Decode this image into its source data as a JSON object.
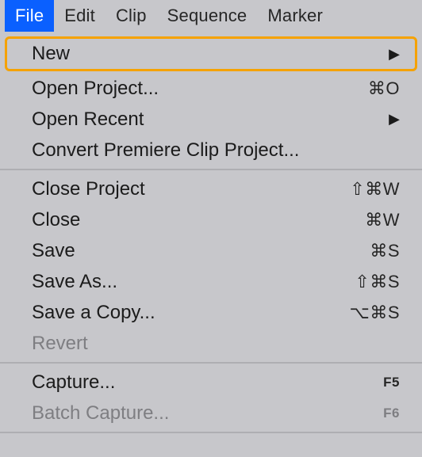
{
  "menubar": {
    "file": {
      "label": "File",
      "active": true
    },
    "edit": {
      "label": "Edit"
    },
    "clip": {
      "label": "Clip"
    },
    "sequence": {
      "label": "Sequence"
    },
    "marker": {
      "label": "Marker"
    }
  },
  "file_menu": {
    "new": {
      "label": "New"
    },
    "open_project": {
      "label": "Open Project...",
      "shortcut": "⌘O"
    },
    "open_recent": {
      "label": "Open Recent"
    },
    "convert": {
      "label": "Convert Premiere Clip Project..."
    },
    "close_project": {
      "label": "Close Project",
      "shortcut": "⇧⌘W"
    },
    "close": {
      "label": "Close",
      "shortcut": "⌘W"
    },
    "save": {
      "label": "Save",
      "shortcut": "⌘S"
    },
    "save_as": {
      "label": "Save As...",
      "shortcut": "⇧⌘S"
    },
    "save_copy": {
      "label": "Save a Copy...",
      "shortcut": "⌥⌘S"
    },
    "revert": {
      "label": "Revert"
    },
    "capture": {
      "label": "Capture...",
      "shortcut": "F5"
    },
    "batch_capture": {
      "label": "Batch Capture...",
      "shortcut": "F6"
    }
  }
}
